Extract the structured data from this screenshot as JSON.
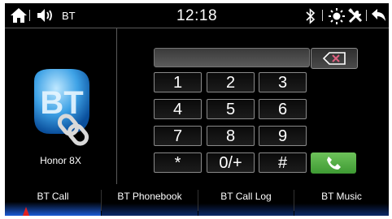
{
  "status_bar": {
    "source": "BT",
    "time": "12:18",
    "icons": [
      "home-icon",
      "volume-icon",
      "bluetooth-icon",
      "brightness-icon",
      "tools-icon",
      "back-icon"
    ]
  },
  "device": {
    "name": "Honor 8X",
    "logo_icon": "bluetooth-link-logo"
  },
  "keypad": {
    "number_display": "",
    "backspace_icon": "backspace-icon",
    "keys": [
      "1",
      "2",
      "3",
      "4",
      "5",
      "6",
      "7",
      "8",
      "9",
      "*",
      "0/+",
      "#"
    ],
    "call_icon": "phone-icon",
    "call_color": "#4caf3c"
  },
  "tabs": [
    {
      "label": "BT Call",
      "active": true
    },
    {
      "label": "BT Phonebook",
      "active": false
    },
    {
      "label": "BT Call Log",
      "active": false
    },
    {
      "label": "BT Music",
      "active": false
    }
  ],
  "colors": {
    "accent": "#1a5bd6",
    "pointer": "#e02020"
  }
}
